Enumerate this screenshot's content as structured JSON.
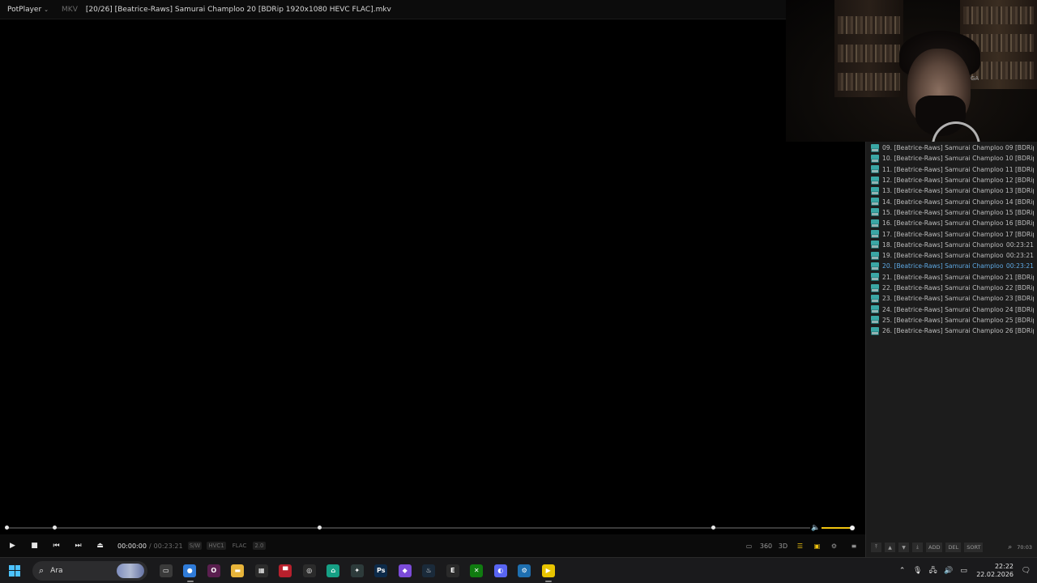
{
  "titlebar": {
    "app_name": "PotPlayer",
    "format": "MKV",
    "title": "[20/26] [Beatrice-Raws] Samurai Champloo 20 [BDRip 1920x1080 HEVC FLAC].mkv"
  },
  "webcam": {
    "label": "GA"
  },
  "playlist": {
    "items": [
      {
        "name": "09. [Beatrice-Raws] Samurai Champloo 09 [BDRip 1...",
        "duration": ""
      },
      {
        "name": "10. [Beatrice-Raws] Samurai Champloo 10 [BDRip 1...",
        "duration": ""
      },
      {
        "name": "11. [Beatrice-Raws] Samurai Champloo 11 [BDRip 1...",
        "duration": ""
      },
      {
        "name": "12. [Beatrice-Raws] Samurai Champloo 12 [BDRip 1...",
        "duration": ""
      },
      {
        "name": "13. [Beatrice-Raws] Samurai Champloo 13 [BDRip 1...",
        "duration": ""
      },
      {
        "name": "14. [Beatrice-Raws] Samurai Champloo 14 [BDRip 1...",
        "duration": ""
      },
      {
        "name": "15. [Beatrice-Raws] Samurai Champloo 15 [BDRip 1...",
        "duration": ""
      },
      {
        "name": "16. [Beatrice-Raws] Samurai Champloo 16 [BDRip 1...",
        "duration": ""
      },
      {
        "name": "17. [Beatrice-Raws] Samurai Champloo 17 [BDRip 1...",
        "duration": ""
      },
      {
        "name": "18. [Beatrice-Raws] Samurai Champloo 18...",
        "duration": "00:23:21"
      },
      {
        "name": "19. [Beatrice-Raws] Samurai Champloo 19...",
        "duration": "00:23:21"
      },
      {
        "name": "20. [Beatrice-Raws] Samurai Champloo 20...",
        "duration": "00:23:21",
        "active": true
      },
      {
        "name": "21. [Beatrice-Raws] Samurai Champloo 21 [BDRip 1...",
        "duration": ""
      },
      {
        "name": "22. [Beatrice-Raws] Samurai Champloo 22 [BDRip 1...",
        "duration": ""
      },
      {
        "name": "23. [Beatrice-Raws] Samurai Champloo 23 [BDRip 1...",
        "duration": ""
      },
      {
        "name": "24. [Beatrice-Raws] Samurai Champloo 24 [BDRip 1...",
        "duration": ""
      },
      {
        "name": "25. [Beatrice-Raws] Samurai Champloo 25 [BDRip 1...",
        "duration": ""
      },
      {
        "name": "26. [Beatrice-Raws] Samurai Champloo 26 [BDRip 1...",
        "duration": ""
      }
    ],
    "active_color": "#5ea8e3",
    "bottom": {
      "add_label": "ADD",
      "del_label": "DEL",
      "sort_label": "SORT",
      "total_time": "70:03"
    }
  },
  "seek": {
    "progress": 0,
    "chapter_marks": [
      0.06,
      0.39,
      0.88
    ],
    "volume": 1.0,
    "volume_color": "#f1c40f"
  },
  "controls": {
    "current_time": "00:00:00",
    "separator": "/",
    "total_time": "00:23:21",
    "decoder": "S/W",
    "video_codec": "HVC1",
    "audio_codec": "FLAC",
    "channels": "2.0",
    "icons": [
      "play-icon",
      "stop-icon",
      "prev-icon",
      "next-icon",
      "eject-icon",
      "screen-icon",
      "360-icon",
      "3d-icon",
      "playlist-search-icon",
      "yellow-note-icon",
      "settings-icon",
      "menu-icon"
    ]
  },
  "taskbar": {
    "search_text": "Ara",
    "apps": [
      {
        "name": "task-view",
        "glyph": "▭",
        "color": "#3a3a3a"
      },
      {
        "name": "chrome",
        "glyph": "●",
        "color": "#2f7bd8",
        "active": true
      },
      {
        "name": "opera-gx",
        "glyph": "O",
        "color": "#5a1f4f"
      },
      {
        "name": "file-explorer",
        "glyph": "▬",
        "color": "#e7b43a"
      },
      {
        "name": "microsoft-store",
        "glyph": "▦",
        "color": "#2c2c2c"
      },
      {
        "name": "app-red",
        "glyph": "▀",
        "color": "#b8202c"
      },
      {
        "name": "obs",
        "glyph": "◎",
        "color": "#2b2b2b"
      },
      {
        "name": "app-green",
        "glyph": "⌂",
        "color": "#16a085"
      },
      {
        "name": "app-dark",
        "glyph": "✦",
        "color": "#2d3b3b"
      },
      {
        "name": "photoshop",
        "glyph": "Ps",
        "color": "#0d2b4a"
      },
      {
        "name": "office",
        "glyph": "◆",
        "color": "#7b4bd9"
      },
      {
        "name": "steam",
        "glyph": "♨",
        "color": "#1a2a3a"
      },
      {
        "name": "epic-games",
        "glyph": "E",
        "color": "#2a2a2a"
      },
      {
        "name": "xbox",
        "glyph": "✕",
        "color": "#107c10"
      },
      {
        "name": "discord",
        "glyph": "◐",
        "color": "#5865f2"
      },
      {
        "name": "app-blue",
        "glyph": "⚙",
        "color": "#1e6fb0"
      },
      {
        "name": "potplayer",
        "glyph": "▶",
        "color": "#e8c400",
        "active": true
      }
    ],
    "clock_time": "22:22",
    "clock_date": "22.02.2026"
  }
}
